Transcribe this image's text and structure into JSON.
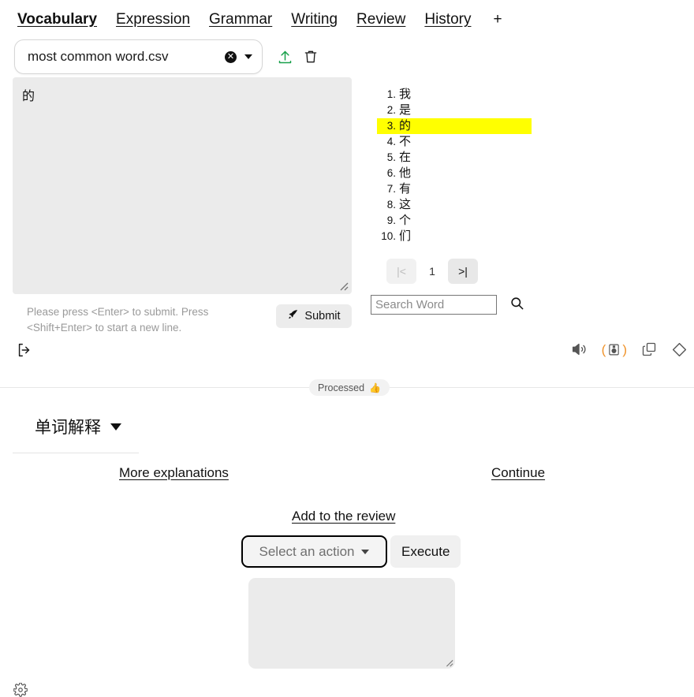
{
  "tabs": [
    {
      "label": "Vocabulary",
      "active": true
    },
    {
      "label": "Expression",
      "active": false
    },
    {
      "label": "Grammar",
      "active": false
    },
    {
      "label": "Writing",
      "active": false
    },
    {
      "label": "Review",
      "active": false
    },
    {
      "label": "History",
      "active": false
    }
  ],
  "tab_add_label": "+",
  "file_selector": {
    "filename": "most common word.csv",
    "clear_label": "×",
    "upload_icon": "upload-icon",
    "delete_icon": "trash-icon"
  },
  "input_area": {
    "value": "的",
    "placeholder": "",
    "hint": "Please press <Enter> to submit. Press <Shift+Enter> to start a new line.",
    "submit_label": "Submit",
    "submit_icon": "rocket-icon",
    "exit_icon": "exit-icon"
  },
  "word_list": {
    "items": [
      {
        "num": "1.",
        "word": "我",
        "highlighted": false
      },
      {
        "num": "2.",
        "word": "是",
        "highlighted": false
      },
      {
        "num": "3.",
        "word": "的",
        "highlighted": true
      },
      {
        "num": "4.",
        "word": "不",
        "highlighted": false
      },
      {
        "num": "5.",
        "word": "在",
        "highlighted": false
      },
      {
        "num": "6.",
        "word": "他",
        "highlighted": false
      },
      {
        "num": "7.",
        "word": "有",
        "highlighted": false
      },
      {
        "num": "8.",
        "word": "这",
        "highlighted": false
      },
      {
        "num": "9.",
        "word": "个",
        "highlighted": false
      },
      {
        "num": "10.",
        "word": "们",
        "highlighted": false
      }
    ],
    "highlight_color": "#ffff00"
  },
  "pagination": {
    "first_label": "|<",
    "page": "1",
    "last_label": ">|"
  },
  "search": {
    "placeholder": "Search Word",
    "value": "",
    "icon": "search-icon"
  },
  "toolbar_icons": [
    {
      "name": "speaker-icon"
    },
    {
      "name": "audio-active-icon",
      "accent": "#f0932b"
    },
    {
      "name": "copy-icon"
    },
    {
      "name": "eraser-icon"
    }
  ],
  "status": {
    "badge_label": "Processed",
    "badge_emoji": "👍"
  },
  "explanation": {
    "title": "单词解释",
    "more_link": "More explanations",
    "continue_link": "Continue",
    "add_review_link": "Add to the review"
  },
  "action": {
    "select_label": "Select an action",
    "execute_label": "Execute",
    "output_value": "",
    "output_placeholder": ""
  },
  "footer": {
    "settings_icon": "gear-icon"
  }
}
